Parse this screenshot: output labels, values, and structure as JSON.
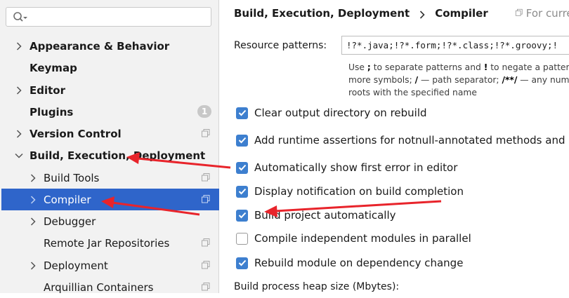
{
  "search": {
    "value": "",
    "placeholder": ""
  },
  "sidebar": {
    "items": [
      {
        "label": "Appearance & Behavior",
        "bold": true,
        "chevron": "right"
      },
      {
        "label": "Keymap",
        "bold": true,
        "chevron": "none"
      },
      {
        "label": "Editor",
        "bold": true,
        "chevron": "right"
      },
      {
        "label": "Plugins",
        "bold": true,
        "chevron": "none",
        "badge": "1"
      },
      {
        "label": "Version Control",
        "bold": true,
        "chevron": "right",
        "icon": "copy-icon"
      },
      {
        "label": "Build, Execution, Deployment",
        "bold": true,
        "chevron": "down"
      },
      {
        "label": "Build Tools",
        "bold": false,
        "chevron": "right",
        "icon": "copy-icon"
      },
      {
        "label": "Compiler",
        "bold": false,
        "chevron": "right",
        "icon": "copy-icon",
        "selected": true
      },
      {
        "label": "Debugger",
        "bold": false,
        "chevron": "right"
      },
      {
        "label": "Remote Jar Repositories",
        "bold": false,
        "chevron": "none",
        "icon": "copy-icon"
      },
      {
        "label": "Deployment",
        "bold": false,
        "chevron": "right",
        "icon": "copy-icon"
      },
      {
        "label": "Arquillian Containers",
        "bold": false,
        "chevron": "none",
        "icon": "copy-icon"
      }
    ]
  },
  "header": {
    "crumb_parent": "Build, Execution, Deployment",
    "crumb_current": "Compiler",
    "scope": "For current p"
  },
  "resource": {
    "label": "Resource patterns:",
    "value": "!?*.java;!?*.form;!?*.class;!?*.groovy;!",
    "hint": {
      "l1_a": "Use ",
      "l1_b": ";",
      "l1_c": " to separate patterns and ",
      "l1_d": "!",
      "l1_e": " to negate a pattern",
      "l2_a": "more symbols; ",
      "l2_b": "/",
      "l2_c": " — path separator; ",
      "l2_d": "/**/",
      "l2_e": " — any num",
      "l3": "roots with the specified name"
    }
  },
  "options": [
    {
      "label": "Clear output directory on rebuild",
      "checked": true
    },
    {
      "label": "Add runtime assertions for notnull-annotated methods and pa",
      "checked": true
    },
    {
      "label": "Automatically show first error in editor",
      "checked": true
    },
    {
      "label": "Display notification on build completion",
      "checked": true
    },
    {
      "label": "Build project automatically",
      "checked": true
    },
    {
      "label": "Compile independent modules in parallel",
      "checked": false
    },
    {
      "label": "Rebuild module on dependency change",
      "checked": true
    }
  ],
  "heap": {
    "label": "Build process heap size (Mbytes):"
  },
  "colors": {
    "selection": "#2f65ca",
    "checkbox": "#3d7fcf",
    "arrow": "#e8242b",
    "sidebar_bg": "#f2f2f2"
  }
}
